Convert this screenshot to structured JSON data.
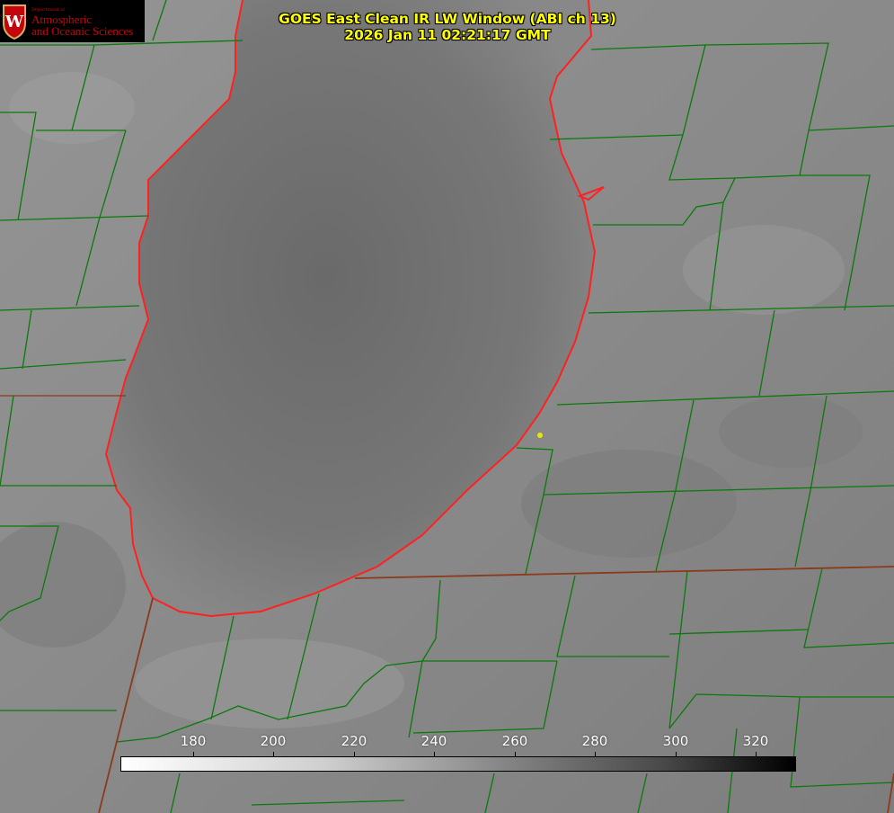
{
  "header": {
    "title_line1": "GOES East Clean IR LW Window (ABI ch 13)",
    "title_line2": "2026 Jan 11 02:21:17 GMT"
  },
  "logo": {
    "dept": "Department of",
    "line1": "Atmospheric",
    "line2": "and Oceanic Sciences",
    "crest_letter": "W"
  },
  "colorbar": {
    "labels": [
      "180",
      "200",
      "220",
      "240",
      "260",
      "280",
      "300",
      "320"
    ],
    "gradient": [
      "#ffffff",
      "#000000"
    ]
  },
  "colors": {
    "county_lines": "#0a7a0a",
    "state_lines": "#8b3a1a",
    "lake_outline": "#ff2020",
    "marker": "#e6e600",
    "title_text": "#ffff00"
  }
}
